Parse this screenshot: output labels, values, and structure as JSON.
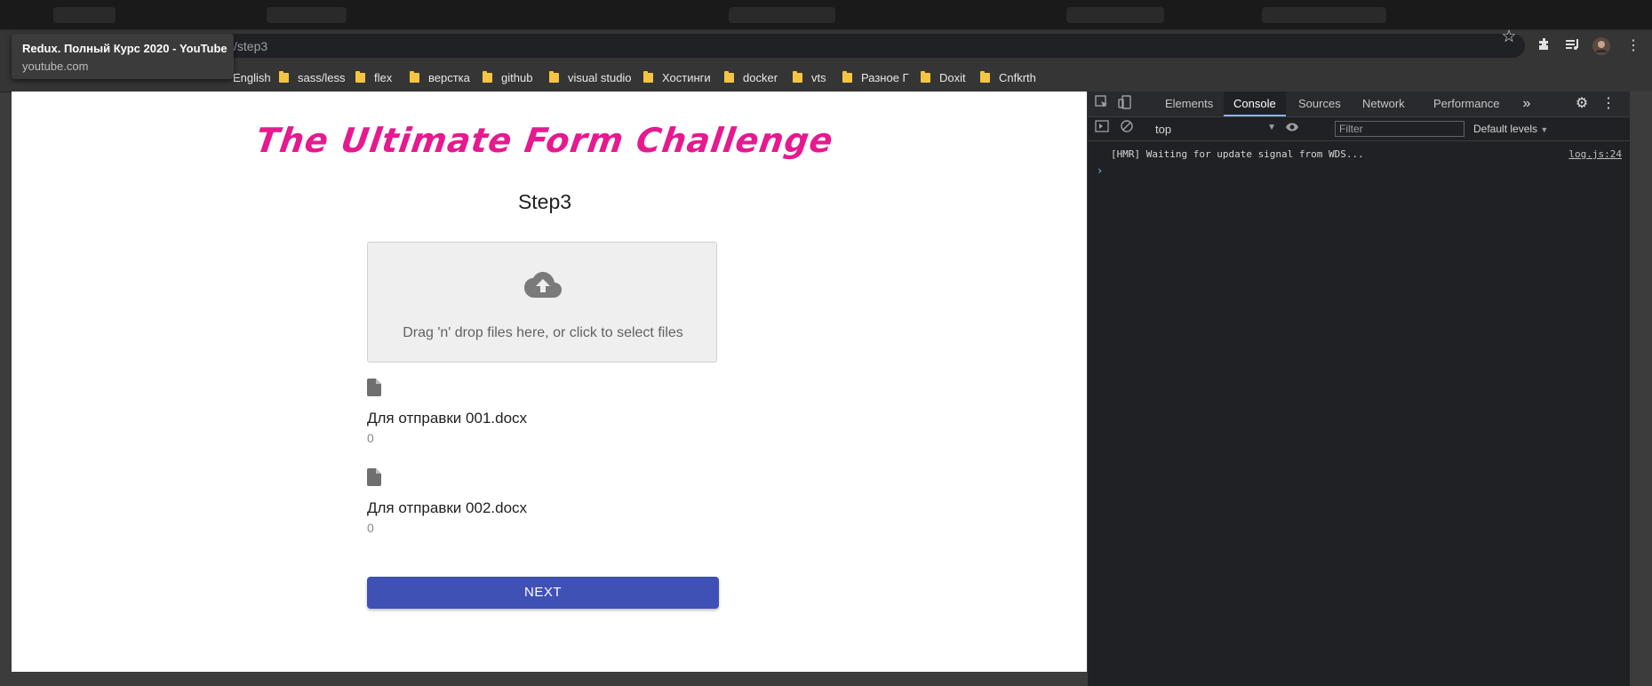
{
  "browser": {
    "url_path": "/step3",
    "bookmarks": [
      "English",
      "sass/less",
      "flex",
      "верстка",
      "github",
      "visual studio",
      "Хостинги",
      "docker",
      "vts",
      "Разное Г",
      "Doxit",
      "Cnfkrth"
    ]
  },
  "tooltip": {
    "title": "Redux. Полный Курс 2020 - YouTube",
    "domain": "youtube.com"
  },
  "page": {
    "hero_title": "The Ultimate Form Challenge",
    "step_title": "Step3",
    "dropzone_text": "Drag 'n' drop files here, or click to select files",
    "files": [
      {
        "name": "Для отправки 001.docx",
        "size": "0"
      },
      {
        "name": "Для отправки 002.docx",
        "size": "0"
      }
    ],
    "next_label": "NEXT"
  },
  "devtools": {
    "tabs": [
      "Elements",
      "Console",
      "Sources",
      "Network",
      "Performance"
    ],
    "active_tab": "Console",
    "context": "top",
    "filter_placeholder": "Filter",
    "levels": "Default levels",
    "message": "[HMR] Waiting for update signal from WDS...",
    "source": "log.js:24"
  },
  "colors": {
    "hero": "#e6198f",
    "next_button": "#3f51b5",
    "devtools_bg": "#202124"
  }
}
